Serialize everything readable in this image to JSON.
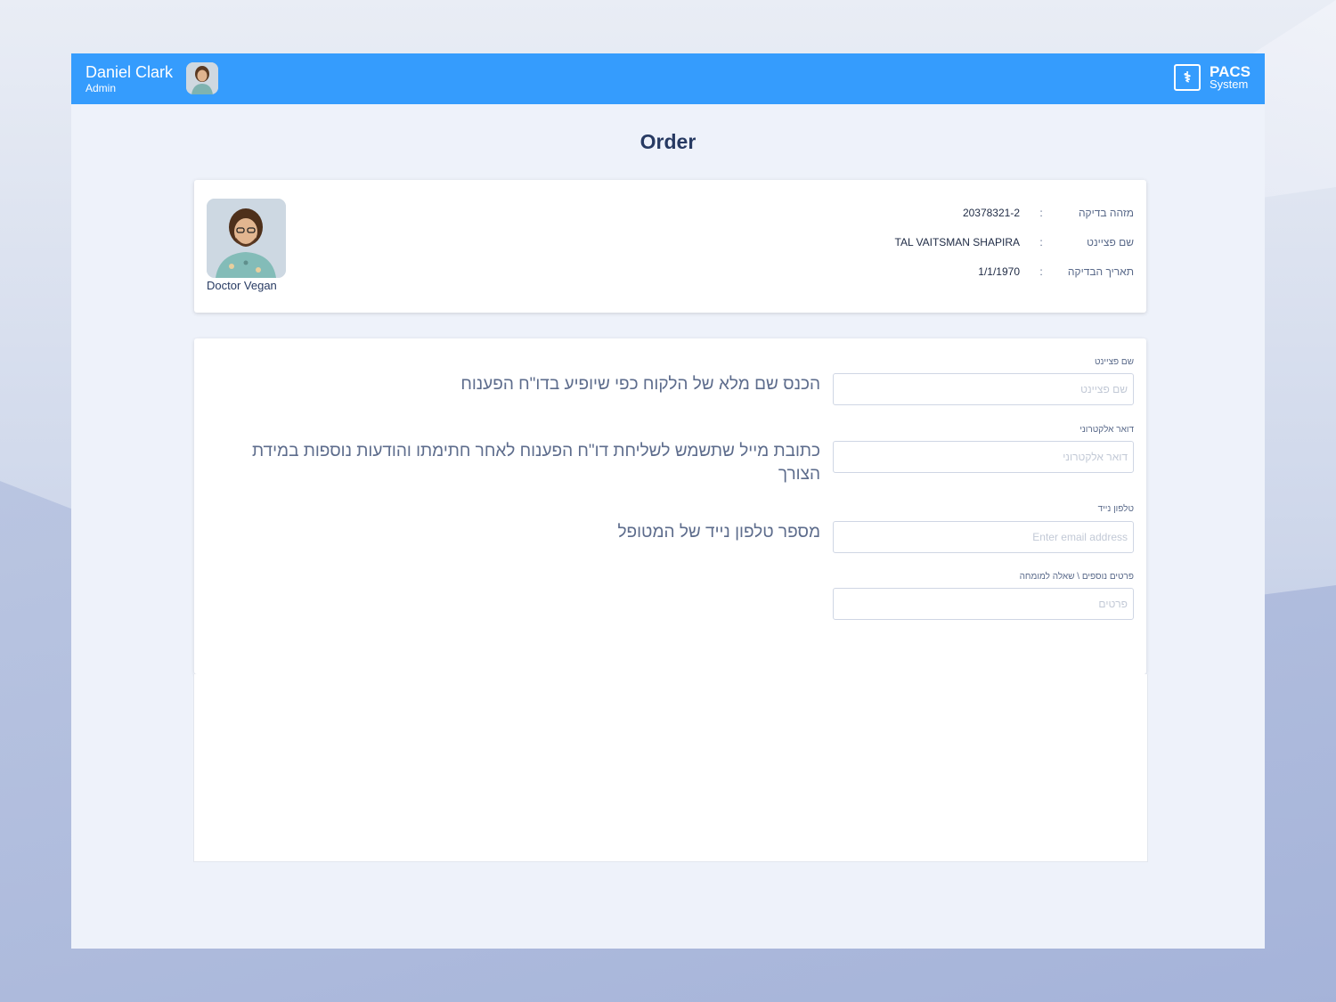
{
  "header": {
    "user_name": "Daniel Clark",
    "user_role": "Admin",
    "logo_line1": "PACS",
    "logo_line2": "System",
    "logo_icon": "medical-document-icon",
    "accent_color": "#359cfd"
  },
  "page": {
    "title": "Order"
  },
  "exam_info": {
    "doctor_name": "Doctor Vegan",
    "rows": [
      {
        "label": "מזהה בדיקה",
        "colon": ":",
        "value": "20378321-2"
      },
      {
        "label": "שם פציינט",
        "colon": ":",
        "value": "TAL VAITSMAN SHAPIRA"
      },
      {
        "label": "תאריך הבדיקה",
        "colon": ":",
        "value": "1/1/1970"
      }
    ]
  },
  "form": {
    "fields": [
      {
        "label": "שם פציינט",
        "placeholder": "שם פציינט",
        "hint": "הכנס שם מלא של הלקוח כפי שיופיע בדו\"ח הפענוח"
      },
      {
        "label": "דואר אלקטרוני",
        "placeholder": "דואר אלקטרוני",
        "hint": "כתובת מייל שתשמש לשליחת דו\"ח הפענוח לאחר חתימתו והודעות נוספות במידת הצורך"
      },
      {
        "label": "טלפון נייד",
        "placeholder": "Enter email address",
        "hint": "מספר טלפון נייד של המטופל"
      },
      {
        "label": "פרטים נוספים \\ שאלה למומחה",
        "placeholder": "פרטים",
        "hint": ""
      }
    ]
  }
}
